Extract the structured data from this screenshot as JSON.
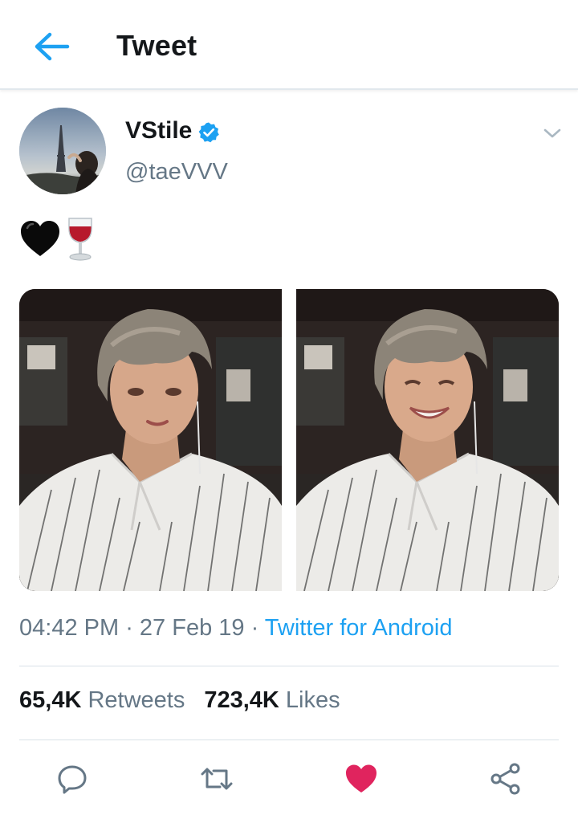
{
  "header": {
    "title": "Tweet",
    "back_icon": "arrow-left-icon",
    "accent_color": "#1da1f2"
  },
  "author": {
    "display_name": "VStile",
    "handle": "@taeVVV",
    "verified": true,
    "verified_icon": "verified-badge-icon"
  },
  "tweet": {
    "emojis": [
      "black-heart-emoji",
      "wine-glass-emoji"
    ],
    "photo_count": 2
  },
  "meta": {
    "time": "04:42 PM",
    "separator": " · ",
    "date": "27 Feb 19",
    "source": "Twitter for Android"
  },
  "stats": {
    "retweets_count": "65,4K",
    "retweets_label": "Retweets",
    "likes_count": "723,4K",
    "likes_label": "Likes"
  },
  "actions": {
    "reply_icon": "reply-icon",
    "retweet_icon": "retweet-icon",
    "like_icon": "heart-icon",
    "like_color": "#e0245e",
    "share_icon": "share-icon"
  }
}
